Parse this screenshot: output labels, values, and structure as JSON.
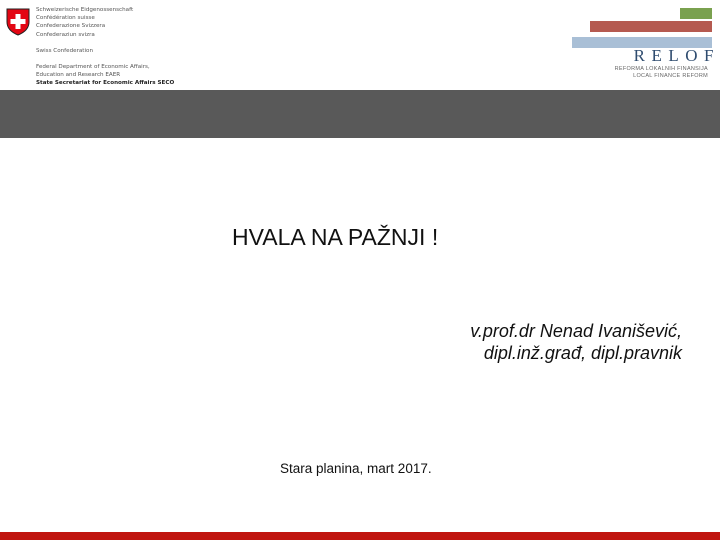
{
  "header": {
    "swiss_logo": {
      "flag_icon": "swiss-cross-icon",
      "lines": [
        "Schweizerische Eidgenossenschaft",
        "Confédération suisse",
        "Confederazione Svizzera",
        "Confederaziun svizra",
        "Swiss Confederation",
        "Federal Department of Economic Affairs,",
        "Education and Research EAER",
        "State Secretariat for Economic Affairs SECO"
      ]
    },
    "relof_logo": {
      "word": "RELOF",
      "subtitle_1": "REFORMA LOKALNIH FINANSIJA",
      "subtitle_2": "LOCAL FINANCE REFORM"
    }
  },
  "colors": {
    "band": "#595959",
    "bottom_stripe": "#c0150f",
    "relof_green": "#7aa14f",
    "relof_red": "#b55a50",
    "relof_blue": "#a9bfd6",
    "relof_text": "#2f4c6f",
    "swiss_red": "#e30613"
  },
  "main": {
    "thanks": "HVALA NA PAŽNJI !",
    "author_line_1": "v.prof.dr Nenad Ivanišević,",
    "author_line_2": "dipl.inž.građ, dipl.pravnik",
    "place_date": "Stara planina, mart 2017."
  }
}
